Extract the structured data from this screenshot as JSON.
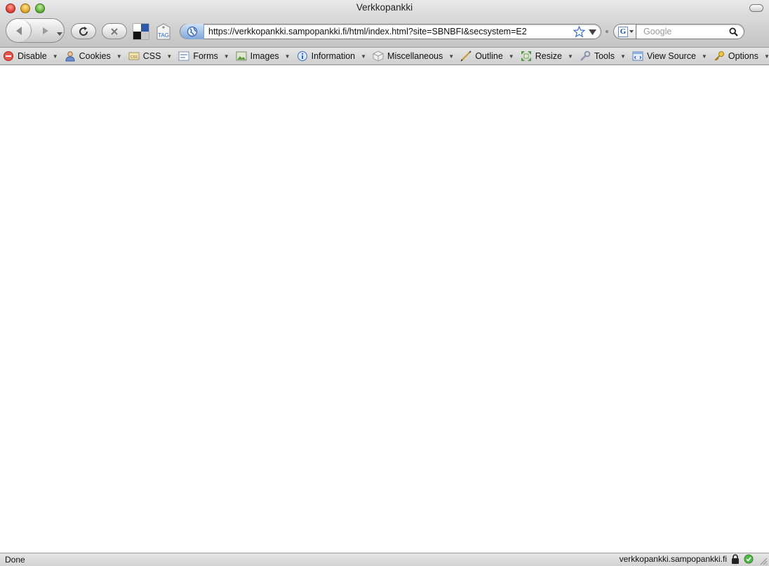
{
  "window": {
    "title": "Verkkopankki"
  },
  "toolbar": {
    "url": "https://verkkopankki.sampopankki.fi/html/index.html?site=SBNBFI&secsystem=E2",
    "tag_label": "TAG",
    "search_placeholder": "Google",
    "search_engine_letter": "G"
  },
  "devbar": {
    "items": [
      {
        "label": "Disable",
        "icon": "disable-icon"
      },
      {
        "label": "Cookies",
        "icon": "cookies-icon"
      },
      {
        "label": "CSS",
        "icon": "css-icon"
      },
      {
        "label": "Forms",
        "icon": "forms-icon"
      },
      {
        "label": "Images",
        "icon": "images-icon"
      },
      {
        "label": "Information",
        "icon": "information-icon"
      },
      {
        "label": "Miscellaneous",
        "icon": "miscellaneous-icon"
      },
      {
        "label": "Outline",
        "icon": "outline-icon"
      },
      {
        "label": "Resize",
        "icon": "resize-icon"
      },
      {
        "label": "Tools",
        "icon": "tools-icon"
      },
      {
        "label": "View Source",
        "icon": "view-source-icon"
      },
      {
        "label": "Options",
        "icon": "options-icon"
      }
    ]
  },
  "status": {
    "left": "Done",
    "domain": "verkkopankki.sampopankki.fi"
  },
  "colors": {
    "accent_blue": "#2b63c7",
    "status_green": "#3aa637",
    "close_red": "#d9372f"
  }
}
